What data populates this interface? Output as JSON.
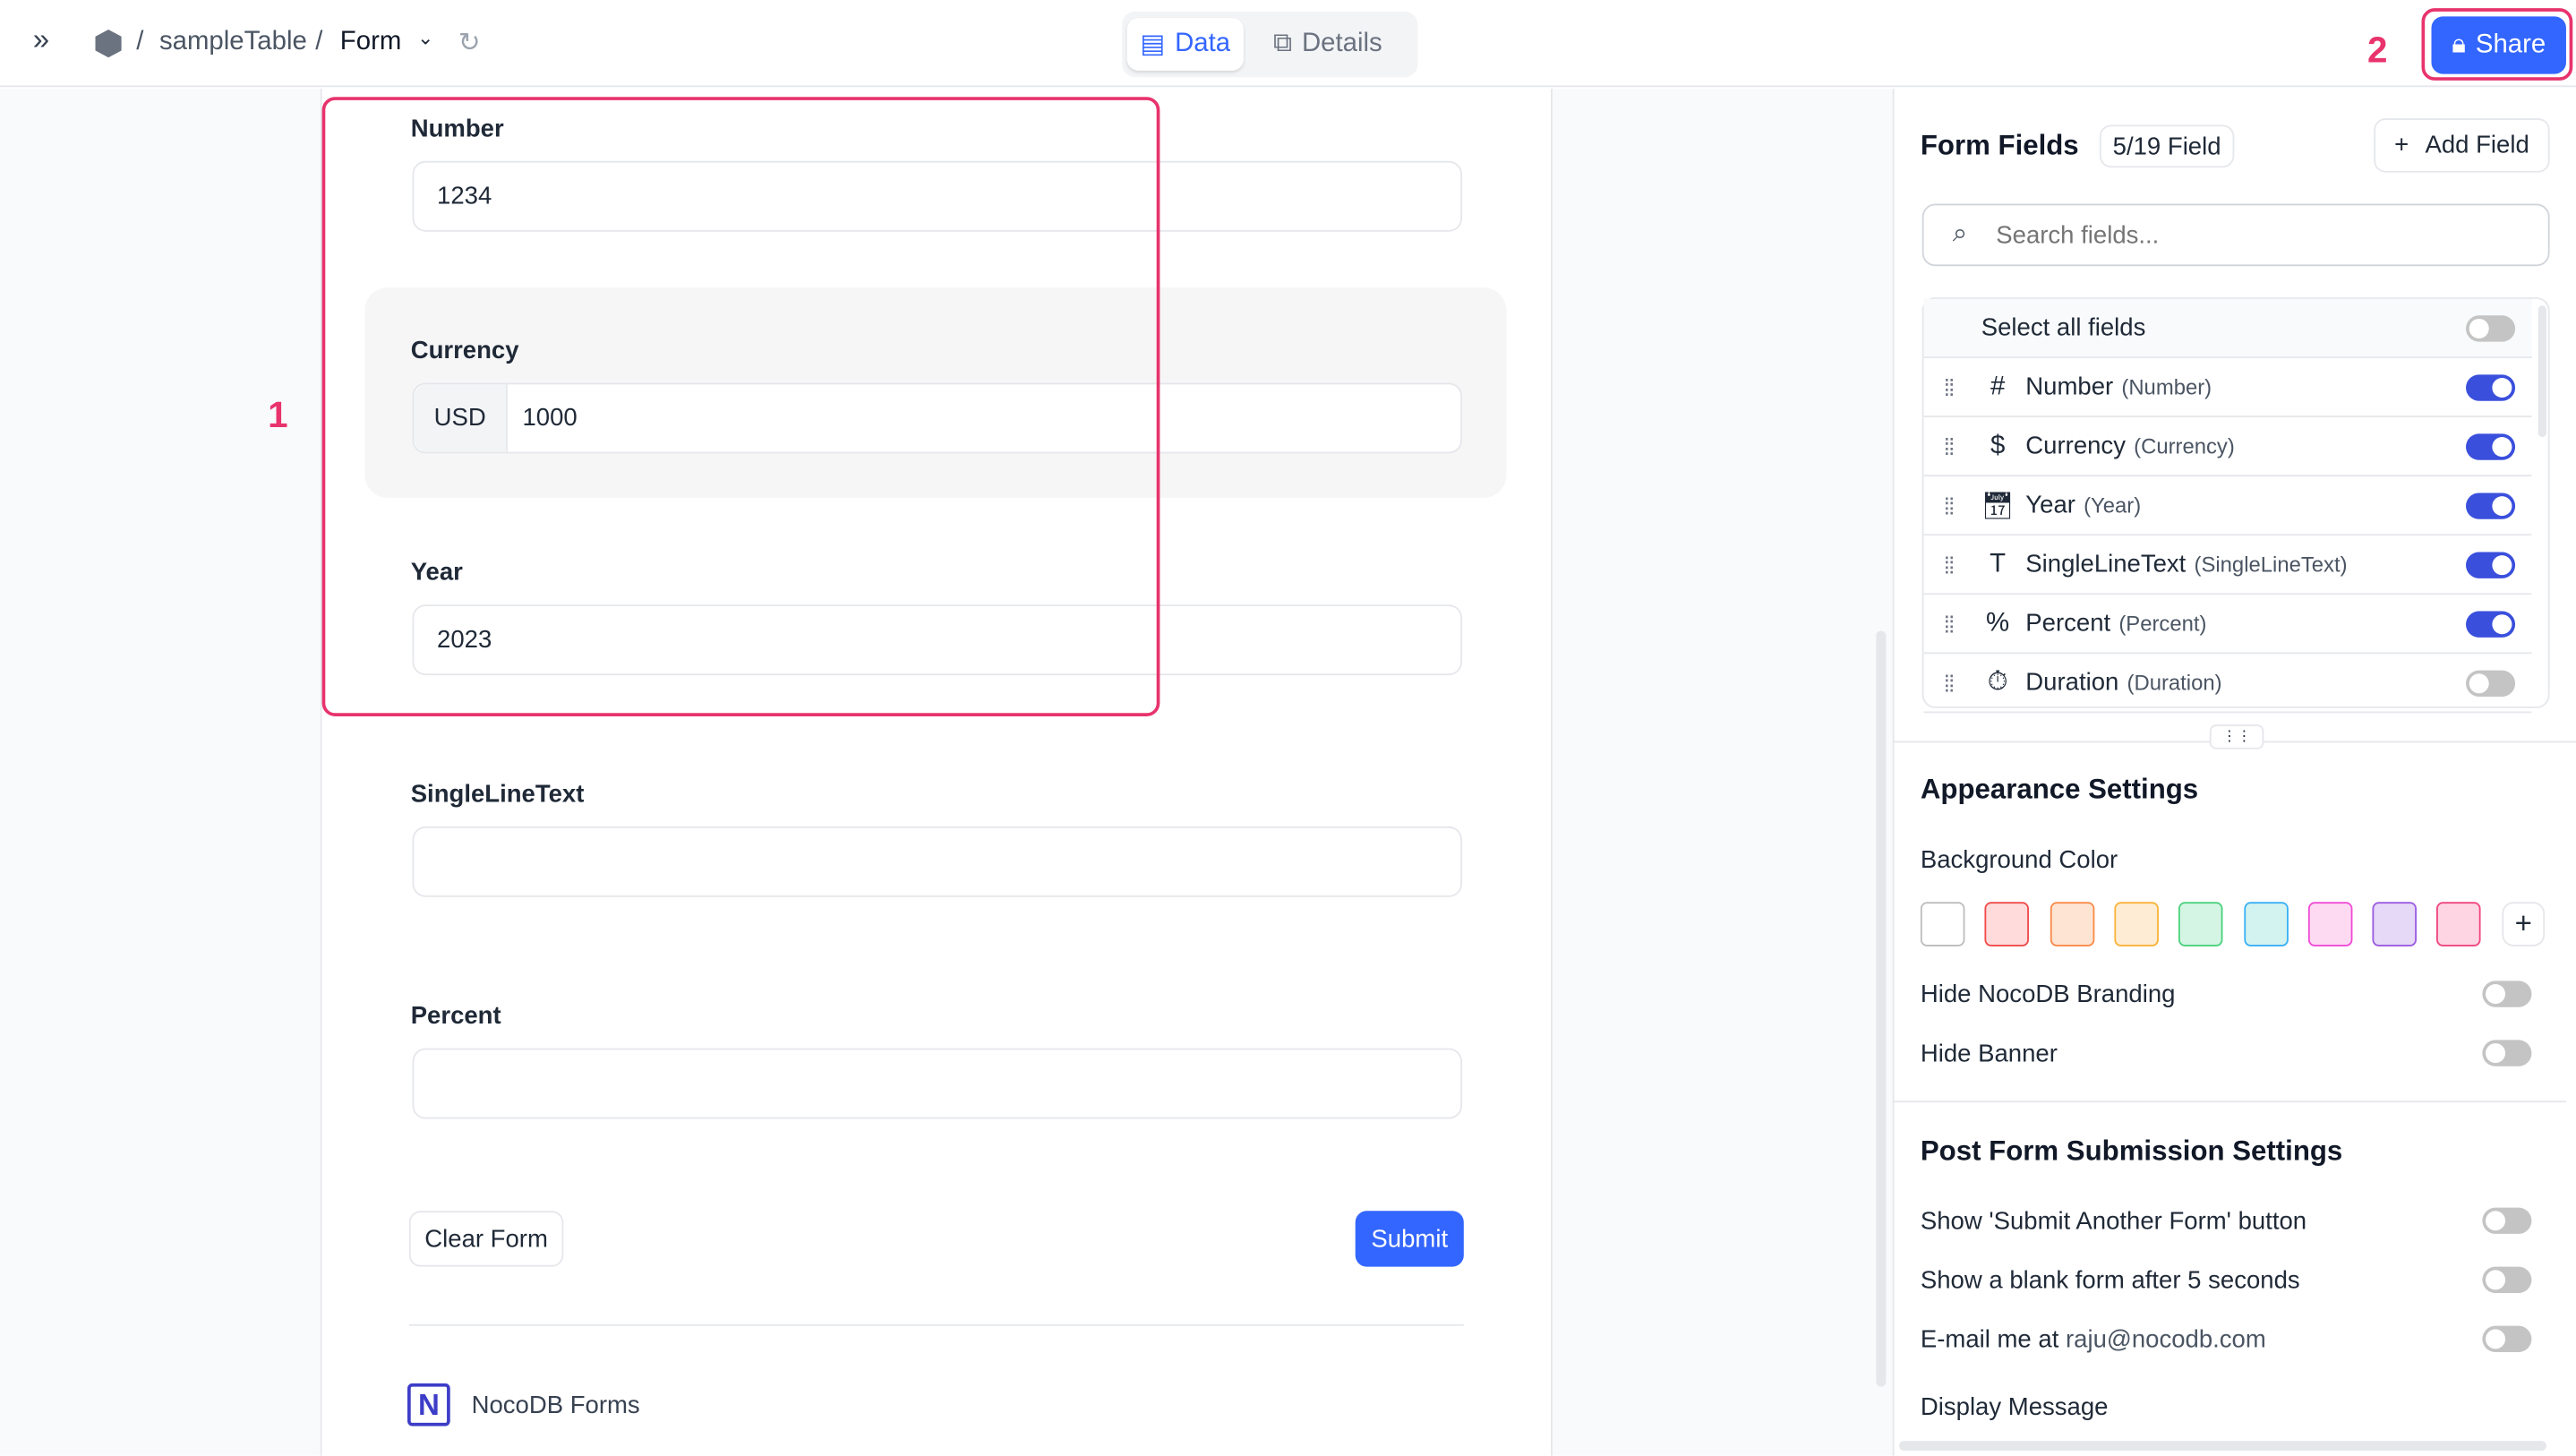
{
  "topbar": {
    "breadcrumb": [
      "sampleTable",
      "Form"
    ],
    "separator": "/",
    "tabs": [
      {
        "label": "Data",
        "active": true
      },
      {
        "label": "Details",
        "active": false
      }
    ],
    "share_label": "Share"
  },
  "form": {
    "fields": [
      {
        "label": "Number",
        "value": "1234"
      },
      {
        "label": "Currency",
        "prefix": "USD",
        "value": "1000"
      },
      {
        "label": "Year",
        "value": "2023"
      },
      {
        "label": "SingleLineText",
        "value": ""
      },
      {
        "label": "Percent",
        "value": ""
      }
    ],
    "clear_label": "Clear Form",
    "submit_label": "Submit",
    "branding": "NocoDB Forms"
  },
  "annotations": [
    "1",
    "2"
  ],
  "panel": {
    "title": "Form Fields",
    "count_badge": "5/19 Field",
    "add_field_label": "Add Field",
    "search_placeholder": "Search fields...",
    "select_all_label": "Select all fields",
    "select_all_on": false,
    "fields": [
      {
        "name": "Number",
        "type": "(Number)",
        "icon": "hash-icon",
        "on": true
      },
      {
        "name": "Currency",
        "type": "(Currency)",
        "icon": "dollar-icon",
        "on": true
      },
      {
        "name": "Year",
        "type": "(Year)",
        "icon": "calendar-icon",
        "on": true
      },
      {
        "name": "SingleLineText",
        "type": "(SingleLineText)",
        "icon": "text-icon",
        "on": true
      },
      {
        "name": "Percent",
        "type": "(Percent)",
        "icon": "percent-icon",
        "on": true
      },
      {
        "name": "Duration",
        "type": "(Duration)",
        "icon": "stopwatch-icon",
        "on": false
      }
    ],
    "appearance": {
      "title": "Appearance Settings",
      "bg_label": "Background Color",
      "swatches": [
        {
          "fill": "#ffffff",
          "border": "#bdbdbd"
        },
        {
          "fill": "#ffdbdb",
          "border": "#f04b4b"
        },
        {
          "fill": "#fee5d3",
          "border": "#f98b4a"
        },
        {
          "fill": "#feedd4",
          "border": "#fbb23a"
        },
        {
          "fill": "#d5f5e4",
          "border": "#4bd27e"
        },
        {
          "fill": "#d3f3f0",
          "border": "#3ab0f5"
        },
        {
          "fill": "#fddaf2",
          "border": "#f04bd7"
        },
        {
          "fill": "#e5d9f7",
          "border": "#9b5be0"
        },
        {
          "fill": "#fed5e3",
          "border": "#f0467e"
        }
      ],
      "hide_branding": "Hide NocoDB Branding",
      "hide_banner": "Hide Banner"
    },
    "post": {
      "title": "Post Form Submission Settings",
      "submit_another": "Show 'Submit Another Form' button",
      "blank_form": "Show a blank form after 5 seconds",
      "email_prefix": "E-mail me at",
      "email": "raju@nocodb.com",
      "display_message": "Display Message"
    }
  },
  "colors": {
    "accent": "#3366ff",
    "toggle_on": "#3a4fdc",
    "annotation": "#e8336d"
  }
}
